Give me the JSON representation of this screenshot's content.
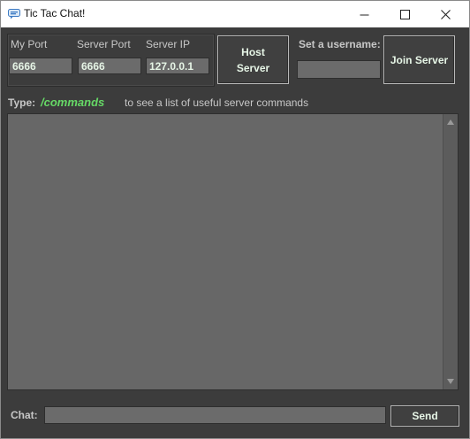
{
  "window": {
    "title": "Tic Tac Chat!",
    "minimize_icon": "minimize-icon",
    "maximize_icon": "maximize-icon",
    "close_icon": "close-icon"
  },
  "connection": {
    "my_port_label": "My Port",
    "my_port_value": "6666",
    "server_port_label": "Server Port",
    "server_port_value": "6666",
    "server_ip_label": "Server IP",
    "server_ip_value": "127.0.0.1",
    "host_button_line1": "Host",
    "host_button_line2": "Server",
    "username_label": "Set a username:",
    "username_value": "",
    "join_button": "Join Server"
  },
  "hint": {
    "prefix": "Type:",
    "command": "/commands",
    "suffix": "to see a list of useful server commands"
  },
  "chat": {
    "label": "Chat:",
    "input_value": "",
    "send_button": "Send"
  },
  "colors": {
    "background": "#3c3c3c",
    "field": "#6b6b6b",
    "accent_green": "#66d966"
  }
}
